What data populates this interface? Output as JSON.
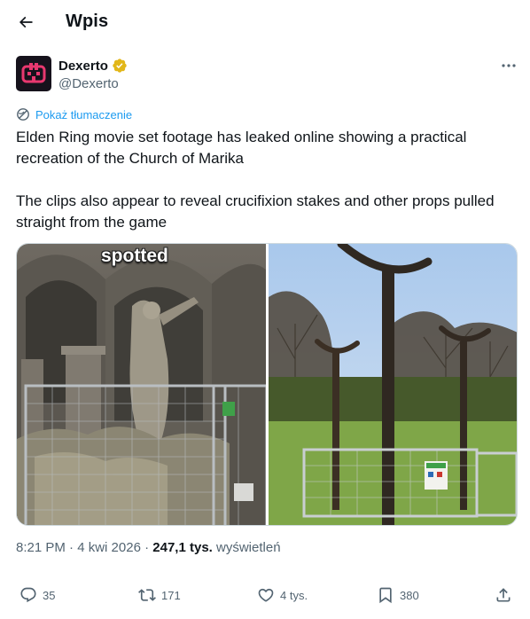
{
  "header": {
    "title": "Wpis",
    "back_icon": "arrow-left-icon"
  },
  "author": {
    "name": "Dexerto",
    "handle": "@Dexerto",
    "verified_badge": "gold-verified-badge-icon",
    "avatar_icon": "dexerto-logo-icon",
    "more_icon": "more-horizontal-icon"
  },
  "translate": {
    "label": "Pokaż tłumaczenie",
    "icon": "globe-icon"
  },
  "tweet": {
    "paragraphs": [
      "Elden Ring movie set footage has leaked online showing a practical recreation of the Church of Marika",
      "The clips also appear to reveal crucifixion stakes and other props pulled straight from the game"
    ]
  },
  "media": {
    "left_caption": "spotted"
  },
  "meta": {
    "time": "8:21 PM",
    "sep1": " · ",
    "date": "4 kwi 2026",
    "sep2": " · ",
    "views_count": "247,1 tys.",
    "views_label": " wyświetleń"
  },
  "actions": {
    "replies": "35",
    "reposts": "171",
    "likes": "4 tys.",
    "bookmarks": "380"
  },
  "colors": {
    "accent": "#1d9bf0",
    "secondary_text": "#536471",
    "primary_text": "#0f1419",
    "verified_gold": "#e2b719"
  }
}
